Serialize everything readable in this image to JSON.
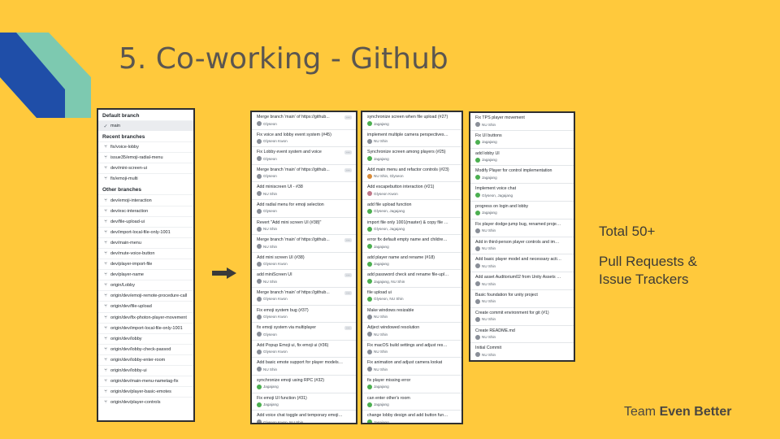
{
  "slide": {
    "title": "5. Co-working - Github",
    "side_text_1": "Total 50+",
    "side_text_2_line1": "Pull Requests &",
    "side_text_2_line2": "Issue Trackers",
    "team_prefix": "Team ",
    "team_name": "Even Better",
    "colors": {
      "background": "#ffc93c",
      "deco_blue": "#1f4ea8",
      "deco_teal": "#7dc9b0"
    }
  },
  "branches_panel": {
    "default_header": "Default branch",
    "default_branch": "main",
    "recent_header": "Recent branches",
    "recent": [
      "fix/voice-lobby",
      "issue35/emoji-radial-menu",
      "dev/mini-screen-ui",
      "fix/emoji-multi"
    ],
    "other_header": "Other branches",
    "other": [
      "dev/emoji-interaction",
      "dev/esc-interaction",
      "dev/file-upload-ui",
      "dev/import-local-file-only-1001",
      "dev/main-menu",
      "dev/mute-voice-button",
      "dev/player-import-file",
      "dev/player-name",
      "origin/Lobby",
      "origin/dev/emoji-remote-procedure-call",
      "origin/dev/file-upload",
      "origin/dev/fix-photon-player-movement",
      "origin/dev/import-local-file-only-1001",
      "origin/dev/lobby",
      "origin/dev/lobby-check-passod",
      "origin/dev/lobby-enter-room",
      "origin/dev/lobby-ui",
      "origin/dev/main-menu-nametag-fix",
      "origin/dev/player-basic-emotes",
      "origin/dev/player-controls"
    ]
  },
  "commits_col1": [
    {
      "title": "Merge branch 'main' of https://github...",
      "author": "Glyseon",
      "av": "gray",
      "ell": true
    },
    {
      "title": "Fix voice and lobby event system (#45)",
      "author": "Glyseon Kwon",
      "av": "gray",
      "ell": false
    },
    {
      "title": "Fix Lobby event system and voice",
      "author": "Glyseon",
      "av": "gray",
      "ell": true
    },
    {
      "title": "Merge branch 'main' of https://github...",
      "author": "Glyseon",
      "av": "gray",
      "ell": true
    },
    {
      "title": "Add miniscreen UI - #38",
      "author": "NU Shin",
      "av": "gray",
      "ell": false
    },
    {
      "title": "Add radial menu for emoji selection",
      "author": "Glyseon",
      "av": "gray",
      "ell": false
    },
    {
      "title": "Revert \"Add mini screen UI (#38)\"",
      "author": "NU Shin",
      "av": "gray",
      "ell": false
    },
    {
      "title": "Merge branch 'main' of https://github...",
      "author": "NU Shin",
      "av": "gray",
      "ell": true
    },
    {
      "title": "Add mini screen UI (#38)",
      "author": "Glyseon Kwon",
      "av": "gray",
      "ell": false
    },
    {
      "title": "add miniScreen UI",
      "author": "NU Shin",
      "av": "gray",
      "ell": true
    },
    {
      "title": "Merge branch 'main' of https://github...",
      "author": "Glyseon Kwon",
      "av": "gray",
      "ell": true
    },
    {
      "title": "Fix emoji system bug (#37)",
      "author": "Glyseon Kwon",
      "av": "gray",
      "ell": false
    },
    {
      "title": "fix emoji system via multiplayer",
      "author": "Glyseon",
      "av": "gray",
      "ell": true
    },
    {
      "title": "Add Popup Emoji ui, fix emoji ui (#36)",
      "author": "Glyseon Kwon",
      "av": "gray",
      "ell": false
    },
    {
      "title": "Add basic emote support for player models (...",
      "author": "NU Shin",
      "av": "gray",
      "ell": false
    },
    {
      "title": "synchronize emoji using RPC (#32)",
      "author": "Jagajang",
      "av": "green",
      "ell": false
    },
    {
      "title": "Fix emoji UI function (#31)",
      "author": "Jagajang",
      "av": "green",
      "ell": false
    },
    {
      "title": "Add voice chat toggle and temporary emoji f...",
      "author": "Glyseon Kwon, NU Shin",
      "av": "gray",
      "ell": false
    }
  ],
  "commits_col2": [
    {
      "title": "synchronize screen when file upload (#27)",
      "author": "Jagajang",
      "av": "green"
    },
    {
      "title": "implement multiple camera perspectives (#26)",
      "author": "NU Shin",
      "av": "gray"
    },
    {
      "title": "Synchronize screen among players (#25)",
      "author": "Jagajang",
      "av": "green"
    },
    {
      "title": "Add main menu and refactor controls (#23)",
      "author": "NU Shin, Glyseon",
      "av": "orange"
    },
    {
      "title": "Add escapebutton interaction (#21)",
      "author": "Glyseon Kwon",
      "av": "pink"
    },
    {
      "title": "add file upload function",
      "author": "Glyseon, Jagajang",
      "av": "green"
    },
    {
      "title": "import file only 1001(master) & copy file to l...",
      "author": "Glyseon, Jagajang",
      "av": "green"
    },
    {
      "title": "error fix default empty name and children bo...",
      "author": "Jagajang",
      "av": "green"
    },
    {
      "title": "add player name and rename (#18)",
      "author": "Jagajang",
      "av": "green"
    },
    {
      "title": "add password check and rename file-upload ...",
      "author": "Jagajang, NU Shin",
      "av": "green"
    },
    {
      "title": "file upload ui",
      "author": "Glyseon, NU Shin",
      "av": "green"
    },
    {
      "title": "Make windows resizable",
      "author": "NU Shin",
      "av": "gray"
    },
    {
      "title": "Adject windowed resolution",
      "author": "NU Shin",
      "av": "gray"
    },
    {
      "title": "Fix macOS build settings and adjust resolution",
      "author": "NU Shin",
      "av": "gray"
    },
    {
      "title": "Fix animation and adjust camera lookat",
      "author": "NU Shin",
      "av": "gray"
    },
    {
      "title": "fix player missing error",
      "author": "Jagajang",
      "av": "green"
    },
    {
      "title": "can enter other's room",
      "author": "Jagajang",
      "av": "green"
    },
    {
      "title": "change lobby design and add button function",
      "author": "Jagajang",
      "av": "green"
    }
  ],
  "commits_col3": [
    {
      "title": "Fix TPS player movement",
      "author": "NU Shin",
      "av": "gray"
    },
    {
      "title": "Fix UI buttons",
      "author": "Jagajang",
      "av": "green"
    },
    {
      "title": "add lobby UI",
      "author": "Jagajang",
      "av": "green"
    },
    {
      "title": "Modify Player for control implementation",
      "author": "Jagajang",
      "av": "green"
    },
    {
      "title": "Implement voice chat",
      "author": "Glyseon, Jagajang",
      "av": "green"
    },
    {
      "title": "progress on login and lobby",
      "author": "Jagajang",
      "av": "green"
    },
    {
      "title": "Fix player dodge-jump bug, renamed project...",
      "author": "NU Shin",
      "av": "gray"
    },
    {
      "title": "Add in third-person player controls and impl...",
      "author": "NU Shin",
      "av": "gray"
    },
    {
      "title": "Add basic player model and necessary actions",
      "author": "NU Shin",
      "av": "gray"
    },
    {
      "title": "Add asset Auditorium02 from Unity Assets St...",
      "author": "NU Shin",
      "av": "gray"
    },
    {
      "title": "Basic foundation for unity project",
      "author": "NU Shin",
      "av": "gray"
    },
    {
      "title": "Create commit environment for git (#1)",
      "author": "NU Shin",
      "av": "gray"
    },
    {
      "title": "Create README.md",
      "author": "NU Shin",
      "av": "gray"
    },
    {
      "title": "Initial Commit",
      "author": "NU Shin",
      "av": "gray"
    }
  ]
}
